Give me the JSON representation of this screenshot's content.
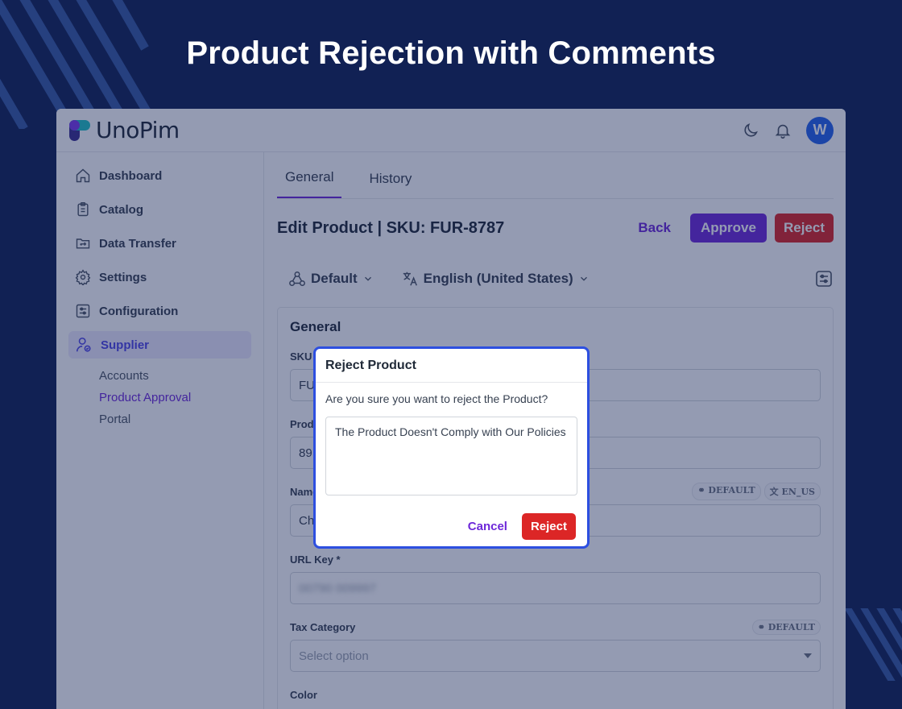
{
  "hero": {
    "title": "Product Rejection with Comments"
  },
  "brand": {
    "name": "UnoPim",
    "avatar_letter": "W"
  },
  "sidebar": {
    "items": [
      {
        "label": "Dashboard",
        "icon": "home-icon"
      },
      {
        "label": "Catalog",
        "icon": "clipboard-icon"
      },
      {
        "label": "Data Transfer",
        "icon": "folder-transfer-icon"
      },
      {
        "label": "Settings",
        "icon": "gear-icon"
      },
      {
        "label": "Configuration",
        "icon": "sliders-icon"
      },
      {
        "label": "Supplier",
        "icon": "supplier-user-icon"
      }
    ],
    "sub_items": [
      {
        "label": "Accounts"
      },
      {
        "label": "Product Approval"
      },
      {
        "label": "Portal"
      }
    ]
  },
  "tabs": [
    {
      "label": "General"
    },
    {
      "label": "History"
    }
  ],
  "page": {
    "title": "Edit Product | SKU: FUR-8787",
    "back_label": "Back",
    "approve_label": "Approve",
    "reject_label": "Reject"
  },
  "filters": {
    "channel": "Default",
    "locale": "English (United States)"
  },
  "form": {
    "section_title": "General",
    "sku_label": "SKU",
    "sku_value": "FU",
    "product_number_label": "Produ",
    "product_number_value": "89",
    "name_label": "Name",
    "name_value": "Ch",
    "chip_default": "DEFAULT",
    "chip_locale": "EN_US",
    "url_key_label": "URL Key *",
    "url_key_value": "00790 009997",
    "tax_label": "Tax Category",
    "tax_placeholder": "Select option",
    "color_label": "Color"
  },
  "modal": {
    "title": "Reject Product",
    "question": "Are you sure you want to reject the Product?",
    "comment": "The Product Doesn't Comply with Our Policies",
    "cancel_label": "Cancel",
    "reject_label": "Reject"
  },
  "colors": {
    "background": "#112154",
    "accent": "#6d28d9",
    "danger": "#dc2626",
    "modal_border": "#2d4fe0"
  }
}
